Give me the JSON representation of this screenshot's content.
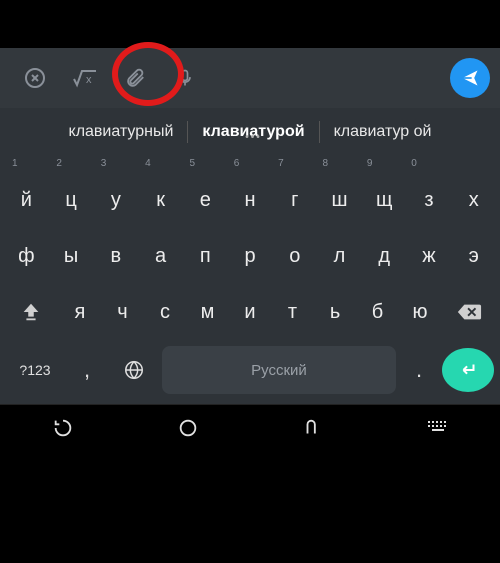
{
  "toolbar": {
    "close_icon": "close",
    "sqrt_icon": "sqrt",
    "attach_icon": "attach",
    "mic_icon": "mic",
    "send_icon": "send"
  },
  "suggestions": {
    "left": "клавиатурный",
    "mid": "клавиатурой",
    "right": "клавиатур ой"
  },
  "numbers": [
    "1",
    "2",
    "3",
    "4",
    "5",
    "6",
    "7",
    "8",
    "9",
    "0"
  ],
  "row1": [
    "й",
    "ц",
    "у",
    "к",
    "е",
    "н",
    "г",
    "ш",
    "щ",
    "з",
    "х"
  ],
  "row2": [
    "ф",
    "ы",
    "в",
    "а",
    "п",
    "р",
    "о",
    "л",
    "д",
    "ж",
    "э"
  ],
  "row3": [
    "я",
    "ч",
    "с",
    "м",
    "и",
    "т",
    "ь",
    "б",
    "ю"
  ],
  "bottom": {
    "sym": "?123",
    "comma": ",",
    "space": "Русский",
    "period": "."
  },
  "colors": {
    "accent_send": "#2196f3",
    "accent_enter": "#26d7b0",
    "annotation": "#e11b1b"
  }
}
